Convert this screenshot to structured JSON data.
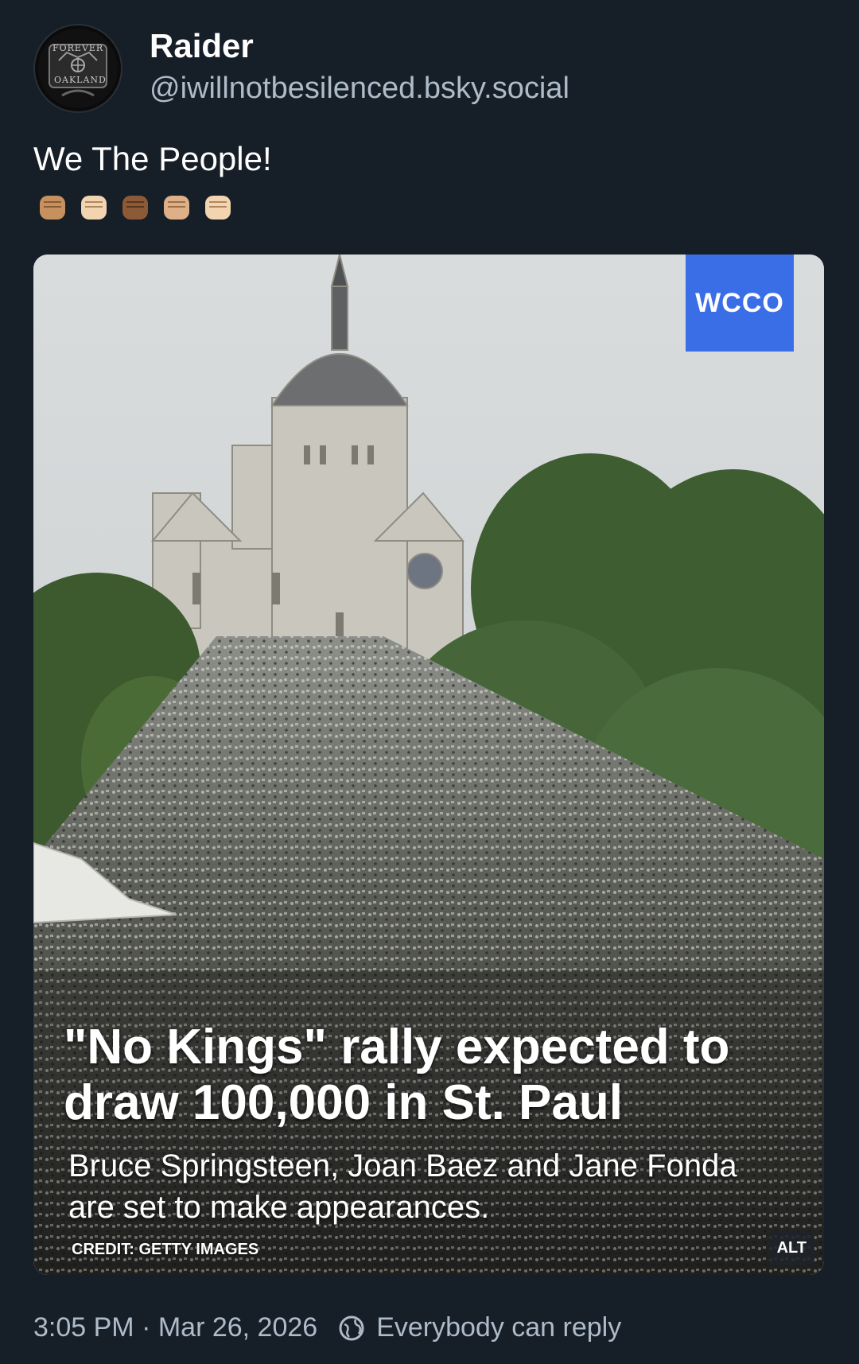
{
  "author": {
    "display_name": "Raider",
    "handle": "@iwillnotbesilenced.bsky.social",
    "avatar_text_top": "FOREVER",
    "avatar_text_bottom": "OAKLAND"
  },
  "post": {
    "text": "We The People!",
    "emoji": [
      "raised-fist-medium",
      "raised-fist-light",
      "raised-fist-dark",
      "raised-fist-medium-light",
      "raised-fist-light"
    ]
  },
  "media": {
    "station_logo": "WCCO",
    "headline": "\"No Kings\" rally expected to draw 100,000 in St. Paul",
    "subhead": "Bruce Springsteen, Joan Baez and Jane Fonda are set to make appearances.",
    "credit": "CREDIT: GETTY IMAGES",
    "alt_badge": "ALT"
  },
  "footer": {
    "timestamp": "3:05 PM · Mar 26, 2026",
    "reply_setting": "Everybody can reply"
  },
  "colors": {
    "background": "#161e27",
    "handle": "#aebbc9",
    "logo_blue": "#3a6ee6"
  }
}
